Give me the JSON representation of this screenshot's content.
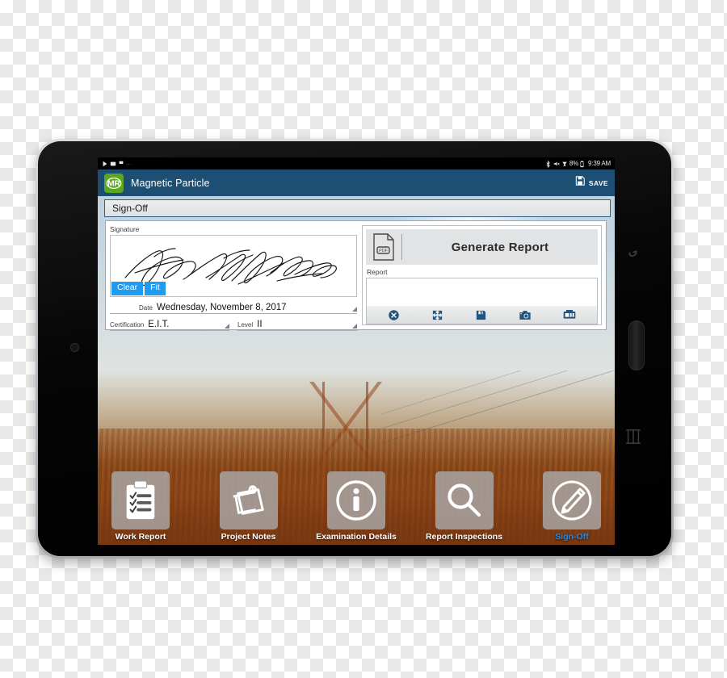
{
  "device": {
    "name": "tablet",
    "hardware_buttons": [
      {
        "name": "back-button",
        "icon": "back-arrow-icon"
      },
      {
        "name": "home-button",
        "icon": "home-pill-icon"
      },
      {
        "name": "recents-button",
        "icon": "recents-bars-icon"
      }
    ],
    "front_camera": "front-camera"
  },
  "status_bar": {
    "left_icons": [
      "play-notification-icon",
      "image-notification-icon",
      "flag-notification-icon"
    ],
    "overflow": "...",
    "right_icons": [
      "bluetooth-icon",
      "mute-icon",
      "wifi-icon",
      "battery-icon"
    ],
    "battery_percent": "8%",
    "time": "9:39 AM"
  },
  "app_bar": {
    "logo_text": "MR",
    "logo_color": "#5aa81f",
    "title": "Magnetic Particle",
    "bar_color": "#1d4f74",
    "save_label": "SAVE",
    "save_icon": "floppy-disk-icon"
  },
  "section": {
    "title": "Sign-Off"
  },
  "signature": {
    "label": "Signature",
    "clear_label": "Clear",
    "fit_label": "Fit",
    "button_color": "#1f9cf0",
    "date": {
      "label": "Date",
      "value": "Wednesday, November 8, 2017"
    },
    "certification": {
      "label": "Certification",
      "value": "E.I.T."
    },
    "level": {
      "label": "Level",
      "value": "II"
    }
  },
  "report": {
    "generate_label": "Generate Report",
    "pdf_icon": "pdf-file-icon",
    "pdf_badge": "PDF",
    "field_label": "Report",
    "content": "",
    "toolbar": [
      {
        "name": "close-icon",
        "label": "Close"
      },
      {
        "name": "fullscreen-icon",
        "label": "Fullscreen"
      },
      {
        "name": "save-floppy-icon",
        "label": "Save"
      },
      {
        "name": "camera-icon",
        "label": "Camera"
      },
      {
        "name": "print-icon",
        "label": "Print"
      }
    ],
    "toolbar_color": "#21557f"
  },
  "bottom_nav": {
    "items": [
      {
        "label": "Work Report",
        "icon": "clipboard-checklist-icon",
        "active": false
      },
      {
        "label": "Project Notes",
        "icon": "sticky-notes-icon",
        "active": false
      },
      {
        "label": "Examination Details",
        "icon": "info-circle-icon",
        "active": false
      },
      {
        "label": "Report Inspections",
        "icon": "magnifier-icon",
        "active": false
      },
      {
        "label": "Sign-Off",
        "icon": "pen-circle-icon",
        "active": true
      }
    ],
    "active_color": "#1f8bf0"
  }
}
